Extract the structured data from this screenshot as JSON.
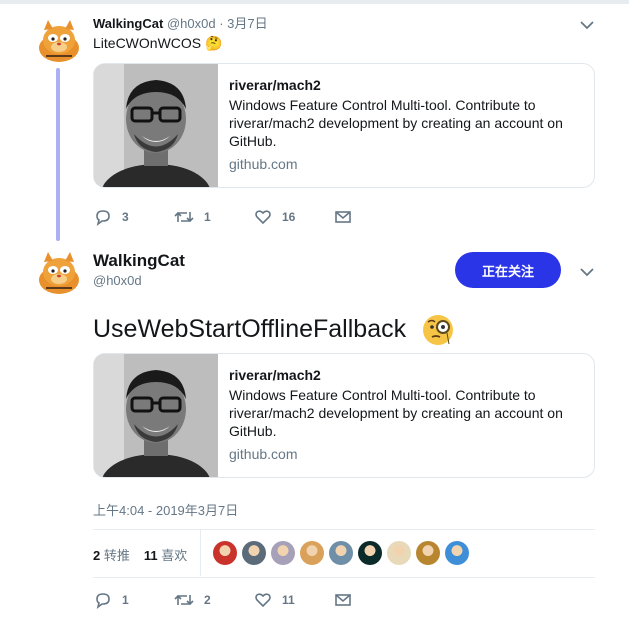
{
  "tweet1": {
    "display_name": "WalkingCat",
    "handle": "@h0x0d",
    "date": "· 3月7日",
    "text": "LiteCWOnWCOS",
    "emoji": "🤔",
    "card": {
      "title": "riverar/mach2",
      "description": "Windows Feature Control Multi-tool. Contribute to riverar/mach2 development by creating an account on GitHub.",
      "domain": "github.com"
    },
    "replies": "3",
    "retweets": "1",
    "likes": "16"
  },
  "tweet2": {
    "display_name": "WalkingCat",
    "handle": "@h0x0d",
    "follow_label": "正在关注",
    "text": "UseWebStartOfflineFallback",
    "card": {
      "title": "riverar/mach2",
      "description": "Windows Feature Control Multi-tool. Contribute to riverar/mach2 development by creating an account on GitHub.",
      "domain": "github.com"
    },
    "timestamp": "上午4:04 - 2019年3月7日",
    "retweet_count": "2",
    "retweet_label": "转推",
    "like_count": "11",
    "like_label": "喜欢",
    "likers": [
      "#c9332b",
      "#5c6b7a",
      "#a6a0b8",
      "#d9a15a",
      "#6f8fa8",
      "#0b2a2a",
      "#e8d9b8",
      "#b8862e",
      "#3e8fd8"
    ],
    "replies": "1",
    "retweets": "2",
    "likes": "11"
  },
  "colors": {
    "accent": "#2b35e8",
    "thread_line": "#aab0f3",
    "muted": "#657786"
  }
}
